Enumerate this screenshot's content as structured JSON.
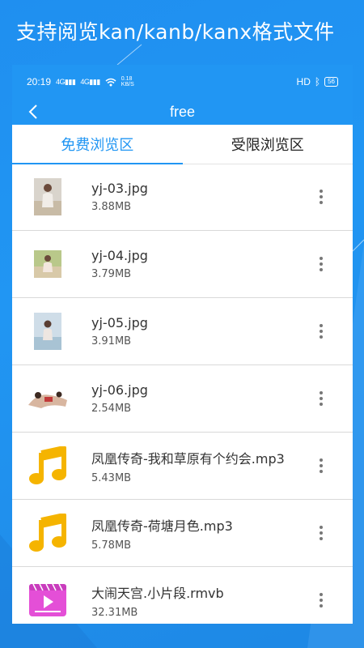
{
  "promo": {
    "headline": "支持阅览kan/kanb/kanx格式文件"
  },
  "status_bar": {
    "time": "20:19",
    "signal_1": "4G",
    "signal_2": "4G",
    "speed_value": "0.18",
    "speed_unit": "KB/S",
    "hd_label": "HD",
    "battery": "56"
  },
  "title_bar": {
    "title": "free"
  },
  "tabs": [
    {
      "label": "免费浏览区",
      "active": true
    },
    {
      "label": "受限浏览区",
      "active": false
    }
  ],
  "files": [
    {
      "name": "yj-03.jpg",
      "size": "3.88MB",
      "icon": "photo-thumbnail-icon"
    },
    {
      "name": "yj-04.jpg",
      "size": "3.79MB",
      "icon": "photo-thumbnail-icon"
    },
    {
      "name": "yj-05.jpg",
      "size": "3.91MB",
      "icon": "photo-thumbnail-icon"
    },
    {
      "name": "yj-06.jpg",
      "size": "2.54MB",
      "icon": "photo-thumbnail-icon"
    },
    {
      "name": "凤凰传奇-我和草原有个约会.mp3",
      "size": "5.43MB",
      "icon": "music-note-icon"
    },
    {
      "name": "凤凰传奇-荷塘月色.mp3",
      "size": "5.78MB",
      "icon": "music-note-icon"
    },
    {
      "name": "大闹天宫.小片段.rmvb",
      "size": "32.31MB",
      "icon": "video-file-icon"
    }
  ],
  "colors": {
    "accent": "#2196f3",
    "music": "#f5b400",
    "video": "#e44fd7"
  }
}
